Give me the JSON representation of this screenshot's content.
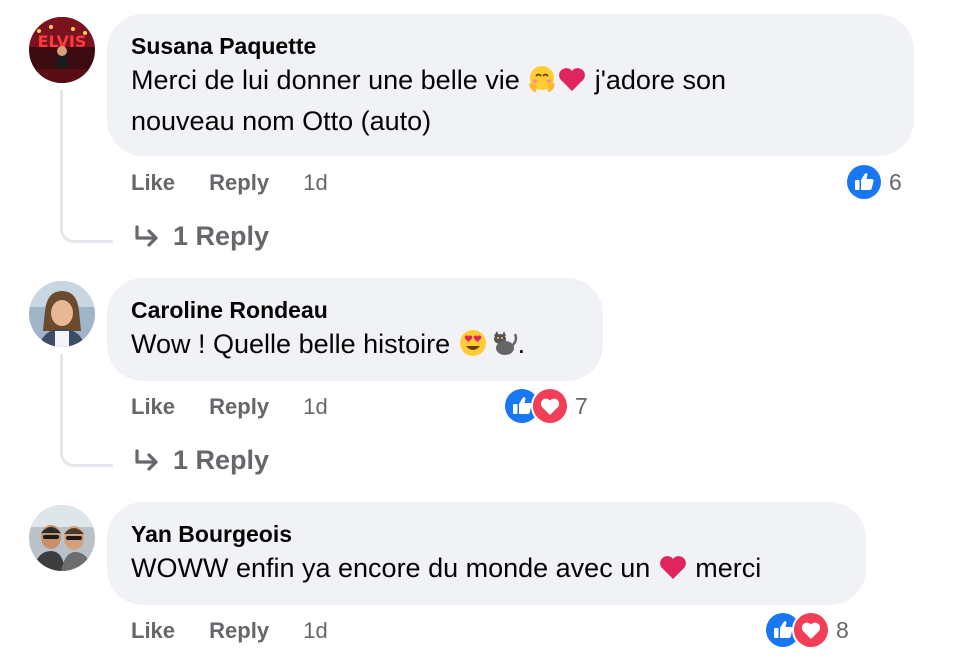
{
  "comments": [
    {
      "author": "Susana Paquette",
      "text_part1": "Merci de lui donner une belle vie ",
      "emojis_inline_1": [
        "smiling-face-with-open-hands",
        "red-heart"
      ],
      "text_part2": " j'adore son",
      "text_line2": "nouveau nom Otto (auto)",
      "like_label": "Like",
      "reply_label": "Reply",
      "time": "1d",
      "reactions": [
        "like"
      ],
      "reaction_count": "6",
      "replies_label": "1 Reply"
    },
    {
      "author": "Caroline Rondeau",
      "text_part1": "Wow ! Quelle belle histoire ",
      "emojis_inline_1": [
        "smiling-face-with-heart-eyes",
        "cat"
      ],
      "text_part2": ".",
      "like_label": "Like",
      "reply_label": "Reply",
      "time": "1d",
      "reactions": [
        "like",
        "love"
      ],
      "reaction_count": "7",
      "replies_label": "1 Reply"
    },
    {
      "author": "Yan Bourgeois",
      "text_part1": "WOWW enfin ya encore du monde avec un ",
      "emojis_inline_1": [
        "red-heart"
      ],
      "text_part2": " merci",
      "like_label": "Like",
      "reply_label": "Reply",
      "time": "1d",
      "reactions": [
        "like",
        "love"
      ],
      "reaction_count": "8"
    }
  ],
  "colors": {
    "bubble_bg": "#f0f2f5",
    "meta_text": "#65676b",
    "like_blue": "#1877f2",
    "love_red": "#f33e58",
    "heart_red": "#e0245e"
  }
}
